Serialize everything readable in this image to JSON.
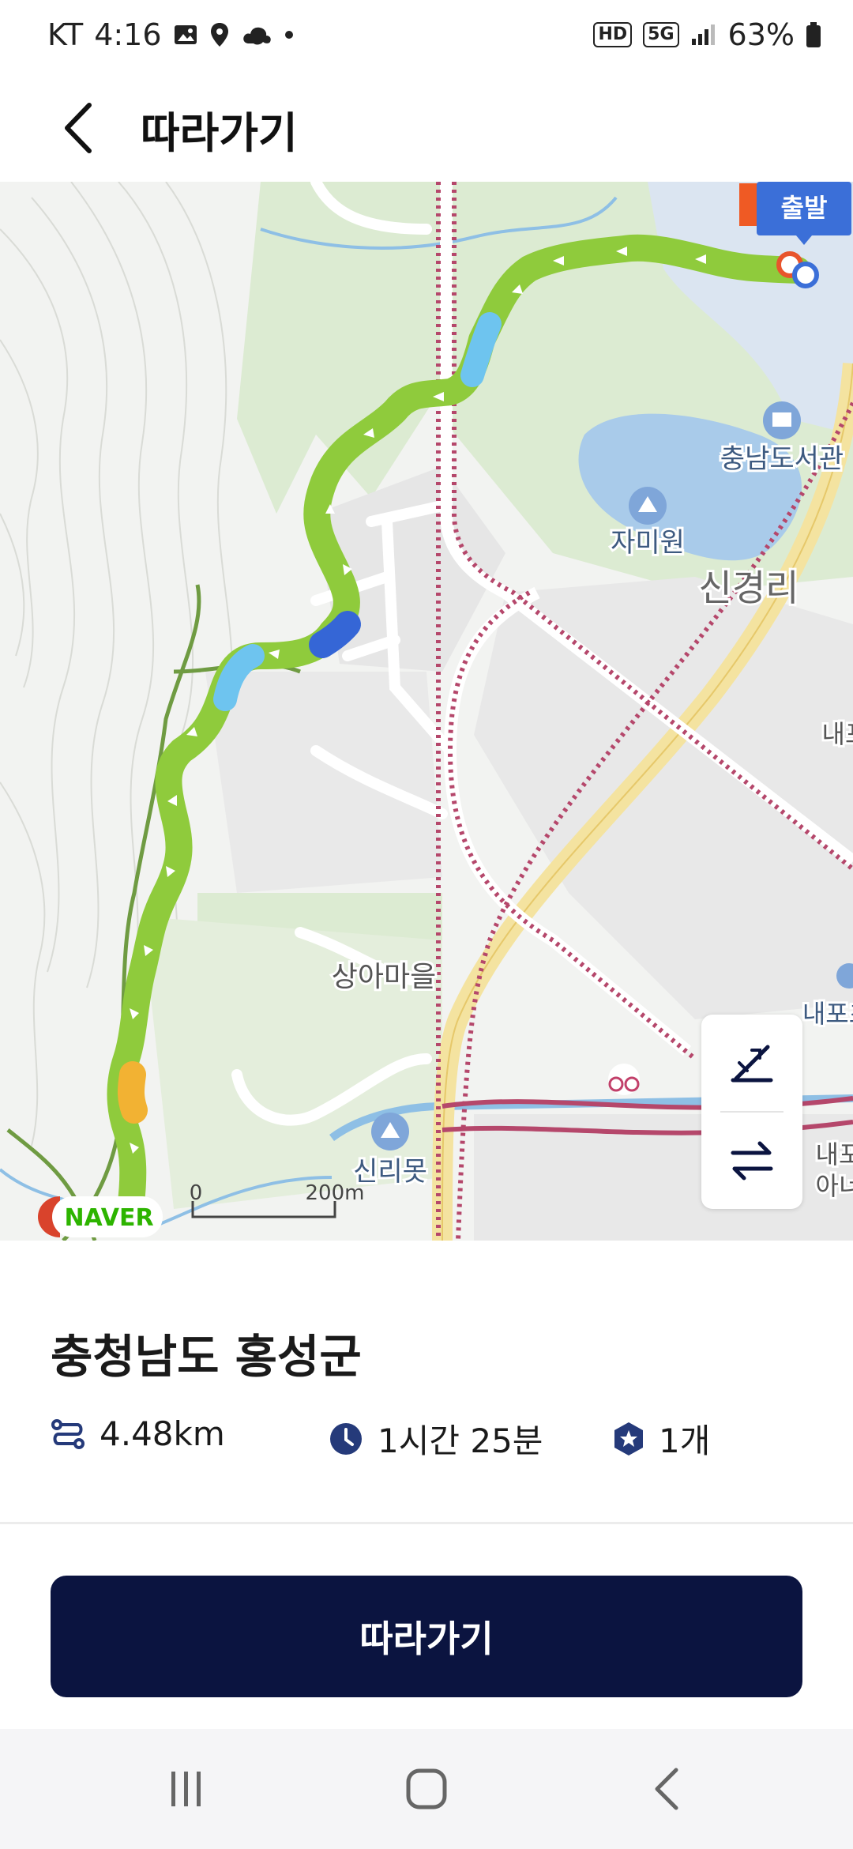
{
  "status_bar": {
    "carrier": "KT",
    "time": "4:16",
    "icons_left": [
      "image-icon",
      "location-icon",
      "cloud-icon",
      "dot-icon"
    ],
    "hd_badge": "HD",
    "network": "5G",
    "battery": "63%"
  },
  "header": {
    "title": "따라가기"
  },
  "map": {
    "start_marker_label": "출발",
    "place_labels": {
      "library": "충남도서관",
      "jamiwon": "자미원",
      "singyeongri": "신경리",
      "sangamaeul": "상아마을",
      "sinrimot": "신리못",
      "naepo_right1": "내포",
      "naepo_right2": "내포초",
      "naepo_right3": "내포",
      "naepo_right4": "아너"
    },
    "scale": {
      "start": "0",
      "end": "200m"
    },
    "naver_logo": "NAVER",
    "colors": {
      "route_green": "#8fcb3c",
      "route_blue": "#6ec4ef",
      "route_dark_blue": "#3566d6",
      "route_orange": "#f2b233",
      "start_badge": "#3b6fd8",
      "lake": "#a9cbea",
      "park": "#dcebd2",
      "highway": "#f4e3a0",
      "rail": "#b5476b"
    }
  },
  "controls": {
    "top_icon": "slope-icon",
    "bottom_icon": "swap-icon"
  },
  "route_info": {
    "region": "충청남도 홍성군",
    "distance": "4.48km",
    "duration": "1시간 25분",
    "waypoints": "1개"
  },
  "follow_button": {
    "label": "따라가기",
    "color": "#0b1440"
  },
  "nav_bar": {
    "items": [
      "recent-apps-icon",
      "home-icon",
      "back-icon"
    ]
  }
}
